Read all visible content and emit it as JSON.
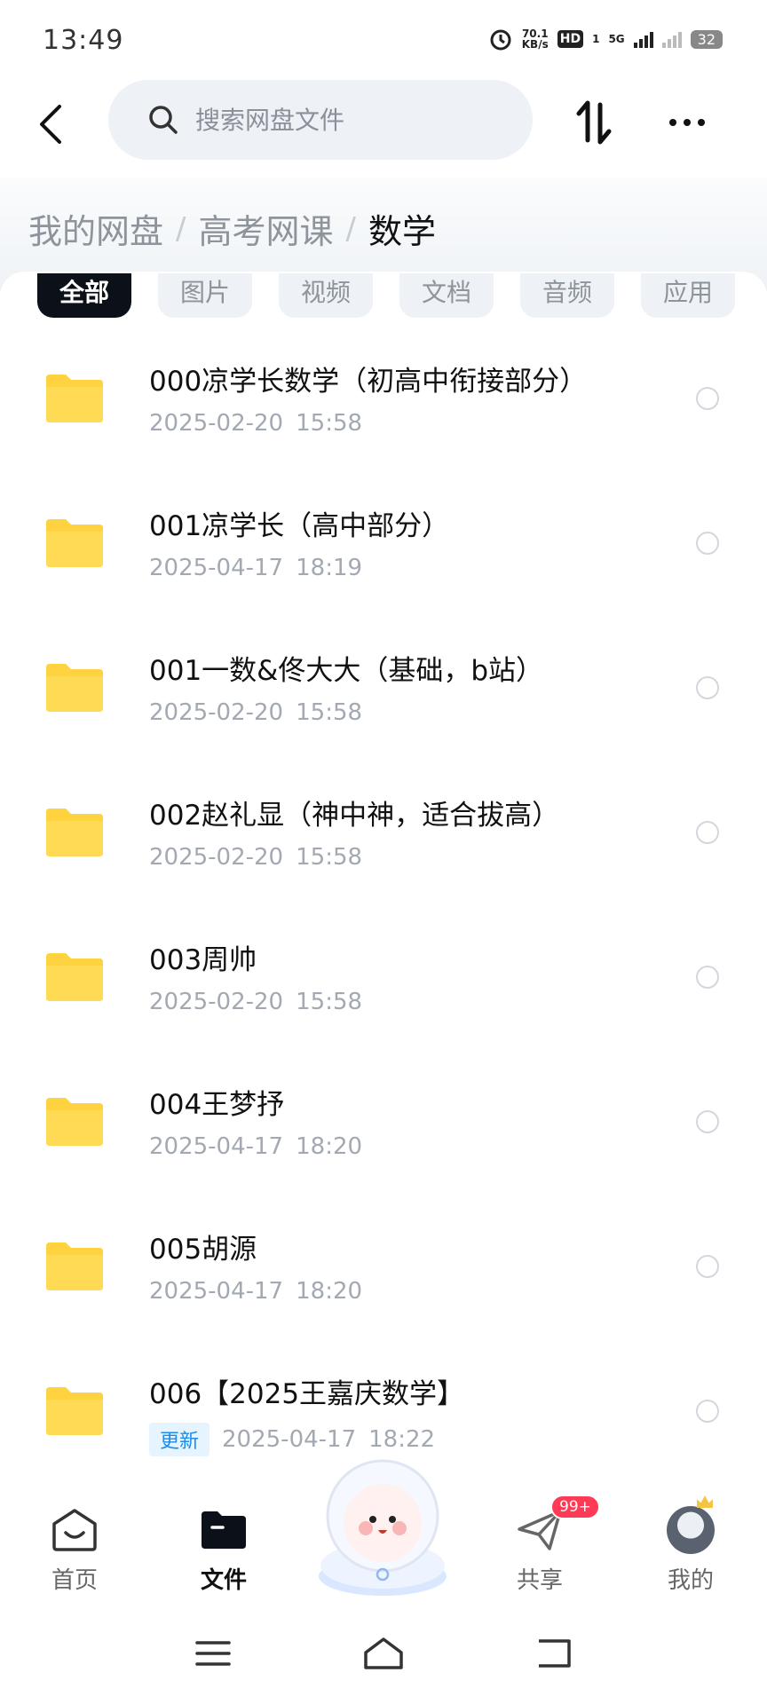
{
  "status_bar": {
    "time": "13:49",
    "speed_value": "70.1",
    "speed_unit": "KB/s",
    "hd_label": "HD",
    "hd_sub": "1",
    "network": "5G",
    "battery": "32"
  },
  "header": {
    "search_placeholder": "搜索网盘文件"
  },
  "breadcrumb": {
    "items": [
      "我的网盘",
      "高考网课",
      "数学"
    ]
  },
  "tabs": [
    "全部",
    "图片",
    "视频",
    "文档",
    "音频",
    "应用"
  ],
  "active_tab": "全部",
  "files": [
    {
      "name": "000凉学长数学（初高中衔接部分）",
      "date": "2025-02-20",
      "time": "15:58",
      "tag": ""
    },
    {
      "name": "001凉学长（高中部分）",
      "date": "2025-04-17",
      "time": "18:19",
      "tag": ""
    },
    {
      "name": "001一数&佟大大（基础，b站）",
      "date": "2025-02-20",
      "time": "15:58",
      "tag": ""
    },
    {
      "name": "002赵礼显（神中神，适合拔高）",
      "date": "2025-02-20",
      "time": "15:58",
      "tag": ""
    },
    {
      "name": "003周帅",
      "date": "2025-02-20",
      "time": "15:58",
      "tag": ""
    },
    {
      "name": "004王梦抒",
      "date": "2025-04-17",
      "time": "18:20",
      "tag": ""
    },
    {
      "name": "005胡源",
      "date": "2025-04-17",
      "time": "18:20",
      "tag": ""
    },
    {
      "name": "006【2025王嘉庆数学】",
      "date": "2025-04-17",
      "time": "18:22",
      "tag": "更新"
    }
  ],
  "bottom_nav": {
    "home": "首页",
    "files": "文件",
    "share": "共享",
    "share_badge": "99+",
    "mine": "我的"
  },
  "colors": {
    "folder": "#ffd23f",
    "accent_dark": "#0c1018",
    "badge": "#ff3a55",
    "update_tag": "#1e8ce8"
  }
}
